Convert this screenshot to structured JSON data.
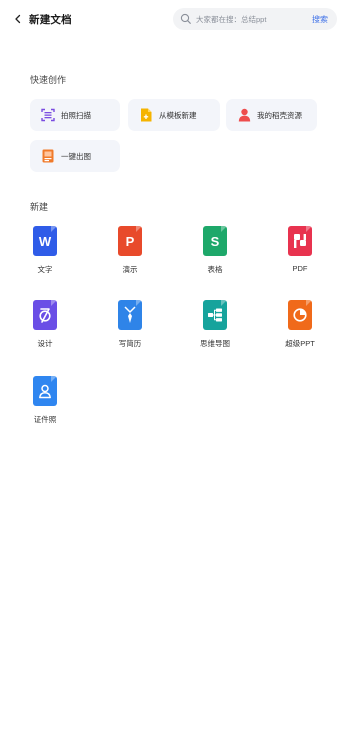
{
  "header": {
    "title": "新建文档",
    "search_placeholder": "大家都在搜：总结ppt",
    "search_button": "搜索"
  },
  "quick_create": {
    "title": "快速创作",
    "items": [
      {
        "label": "拍照扫描",
        "icon": "scan-icon",
        "color": "#7a4ce0"
      },
      {
        "label": "从模板新建",
        "icon": "template-file-icon",
        "color": "#f5b400"
      },
      {
        "label": "我的稻壳资源",
        "icon": "person-icon",
        "color": "#ee4d4d"
      },
      {
        "label": "一键出图",
        "icon": "image-doc-icon",
        "color": "#f07a2a"
      }
    ]
  },
  "new": {
    "title": "新建",
    "items": [
      {
        "label": "文字",
        "icon": "word-doc-icon",
        "color": "#2f5ce8",
        "glyph": "W"
      },
      {
        "label": "演示",
        "icon": "presentation-icon",
        "color": "#e84a2b",
        "glyph": "P"
      },
      {
        "label": "表格",
        "icon": "spreadsheet-icon",
        "color": "#1ea86a",
        "glyph": "S"
      },
      {
        "label": "PDF",
        "icon": "pdf-icon",
        "color": "#e8334f",
        "glyph": ""
      },
      {
        "label": "设计",
        "icon": "design-icon",
        "color": "#6a4ee6",
        "glyph": ""
      },
      {
        "label": "写简历",
        "icon": "resume-icon",
        "color": "#2f84e8",
        "glyph": ""
      },
      {
        "label": "思维导图",
        "icon": "mindmap-icon",
        "color": "#16a39c",
        "glyph": ""
      },
      {
        "label": "超级PPT",
        "icon": "super-ppt-icon",
        "color": "#f06a1a",
        "glyph": ""
      },
      {
        "label": "证件照",
        "icon": "id-photo-icon",
        "color": "#2f86f0",
        "glyph": ""
      }
    ]
  }
}
